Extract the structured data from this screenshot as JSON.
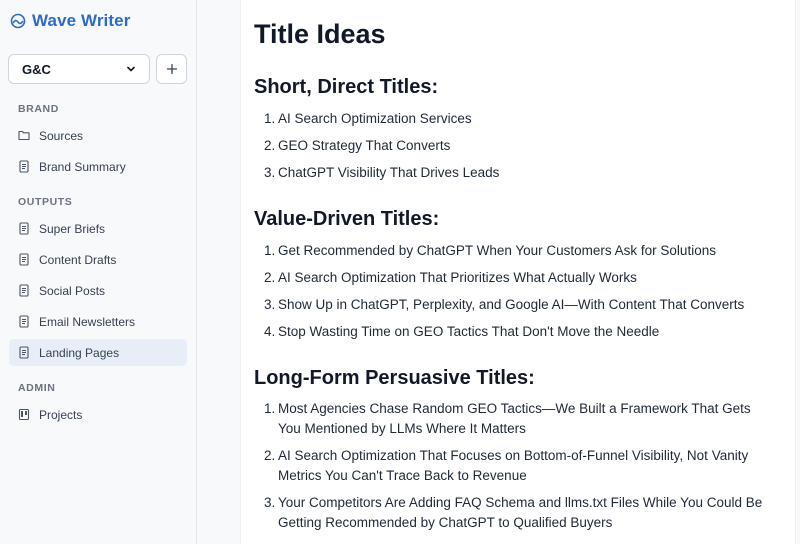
{
  "app": {
    "name": "Wave Writer"
  },
  "workspace": {
    "selected": "G&C"
  },
  "sidebar": {
    "sections": [
      {
        "label": "BRAND",
        "items": [
          {
            "label": "Sources"
          },
          {
            "label": "Brand Summary"
          }
        ]
      },
      {
        "label": "OUTPUTS",
        "items": [
          {
            "label": "Super Briefs"
          },
          {
            "label": "Content Drafts"
          },
          {
            "label": "Social Posts"
          },
          {
            "label": "Email Newsletters"
          },
          {
            "label": "Landing Pages",
            "active": true
          }
        ]
      },
      {
        "label": "ADMIN",
        "items": [
          {
            "label": "Projects"
          }
        ]
      }
    ]
  },
  "document": {
    "title": "Title Ideas",
    "sections": [
      {
        "heading": "Short, Direct Titles:",
        "items": [
          "AI Search Optimization Services",
          "GEO Strategy That Converts",
          "ChatGPT Visibility That Drives Leads"
        ]
      },
      {
        "heading": "Value-Driven Titles:",
        "items": [
          "Get Recommended by ChatGPT When Your Customers Ask for Solutions",
          "AI Search Optimization That Prioritizes What Actually Works",
          "Show Up in ChatGPT, Perplexity, and Google AI—With Content That Converts",
          "Stop Wasting Time on GEO Tactics That Don't Move the Needle"
        ]
      },
      {
        "heading": "Long-Form Persuasive Titles:",
        "items": [
          "Most Agencies Chase Random GEO Tactics—We Built a Framework That Gets You Mentioned by LLMs Where It Matters",
          "AI Search Optimization That Focuses on Bottom-of-Funnel Visibility, Not Vanity Metrics You Can't Trace Back to Revenue",
          "Your Competitors Are Adding FAQ Schema and llms.txt Files While You Could Be Getting Recommended by ChatGPT to Qualified Buyers"
        ]
      }
    ]
  },
  "colors": {
    "brand": "#2f6ac9",
    "active_bg": "#e8eef8",
    "text": "#111827",
    "muted": "#6b7280"
  },
  "icons": {
    "brand": "wave-icon",
    "workspace_toggle": "chevron-down-icon",
    "add": "plus-icon",
    "folder": "folder-icon",
    "document": "document-icon",
    "projects": "kanban-icon"
  }
}
